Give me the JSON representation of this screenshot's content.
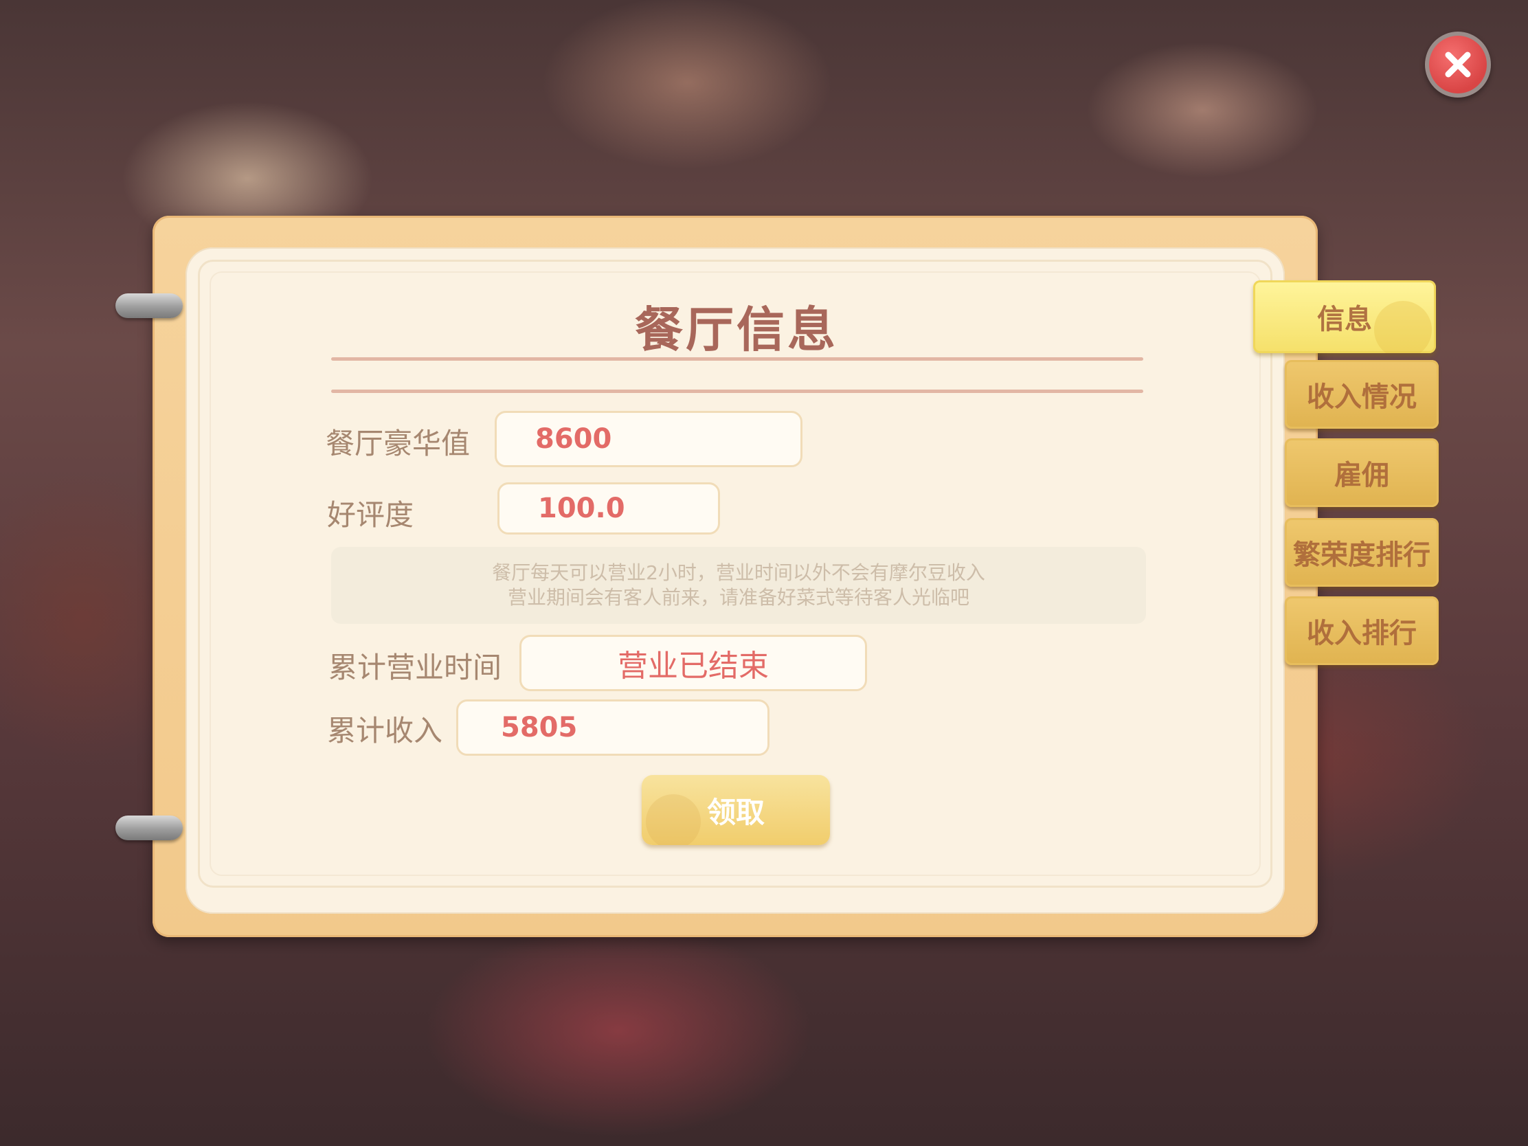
{
  "panel": {
    "title": "餐厅信息"
  },
  "fields": {
    "luxury_label": "餐厅豪华值",
    "luxury_value": "8600",
    "rating_label": "好评度",
    "rating_value": "100.0",
    "business_time_label": "累计营业时间",
    "business_time_value": "营业已结束",
    "income_label": "累计收入",
    "income_value": "5805"
  },
  "notice": {
    "line1": "餐厅每天可以营业2小时，营业时间以外不会有摩尔豆收入",
    "line2": "营业期间会有客人前来，请准备好菜式等待客人光临吧"
  },
  "claim_button": {
    "label": "领取"
  },
  "tabs": [
    {
      "label": "信息",
      "active": true
    },
    {
      "label": "收入情况",
      "active": false
    },
    {
      "label": "雇佣",
      "active": false
    },
    {
      "label": "繁荣度排行",
      "active": false
    },
    {
      "label": "收入排行",
      "active": false
    }
  ],
  "icons": {
    "close": "close-icon"
  },
  "colors": {
    "title": "#a8675a",
    "value_text": "#e36b67",
    "close_button": "#e05050",
    "tab_active": "#f8ea80",
    "tab_inactive": "#e8be5e"
  }
}
